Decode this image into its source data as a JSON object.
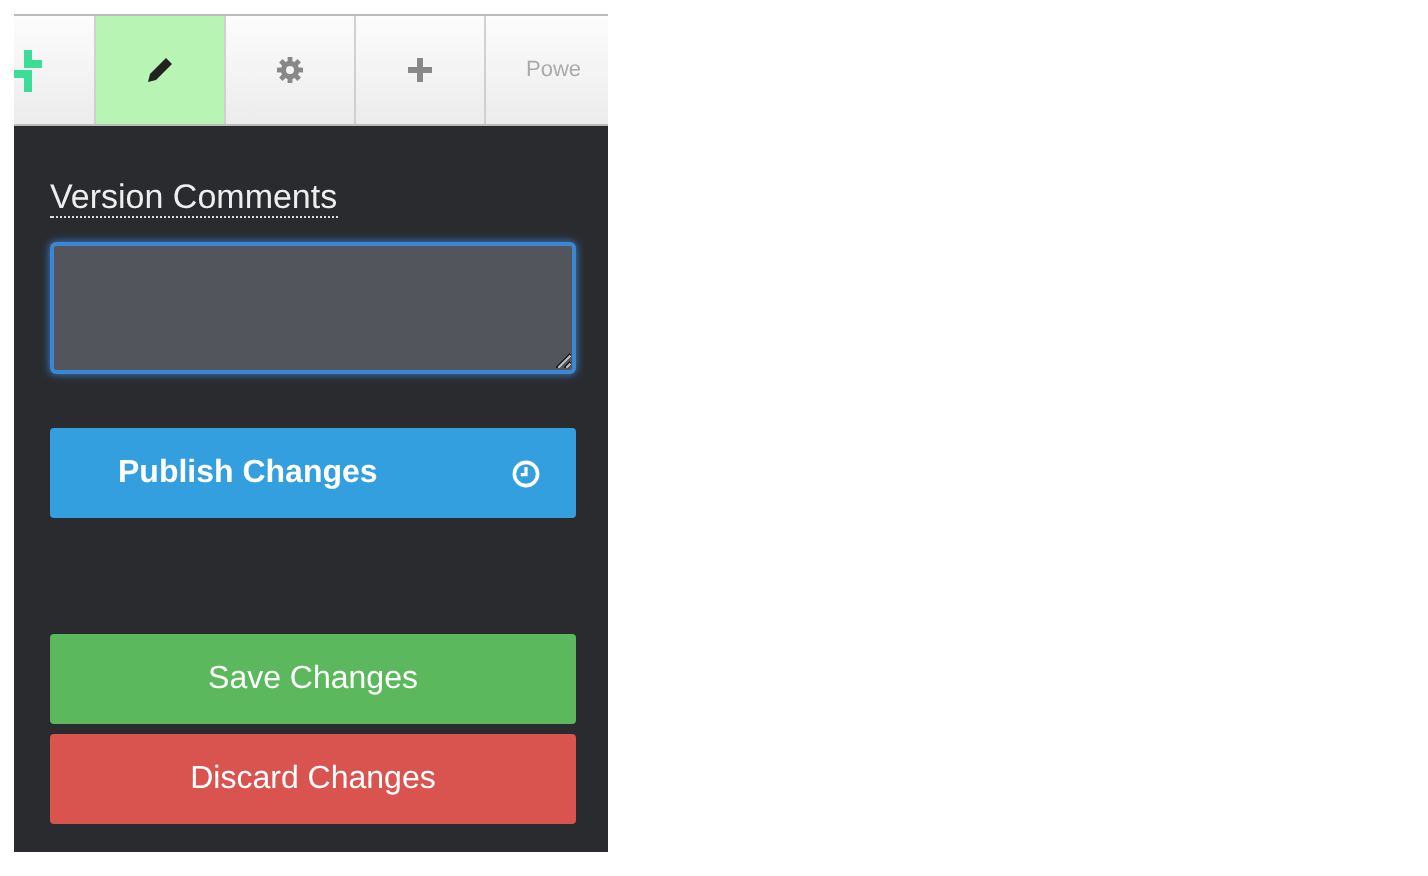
{
  "toolbar": {
    "tabs": [
      {
        "kind": "logo",
        "selected": false
      },
      {
        "kind": "pencil",
        "selected": true
      },
      {
        "kind": "gear",
        "selected": false
      },
      {
        "kind": "plus",
        "selected": false
      },
      {
        "kind": "text",
        "label": "Powe",
        "selected": false
      }
    ]
  },
  "form": {
    "label": "Version Comments",
    "comment_field": {
      "focused": true
    },
    "publish_button": {
      "label": "Publish Changes"
    },
    "save_button": {
      "label": "Save Changes"
    },
    "discard_button": {
      "label": "Discard Changes"
    }
  }
}
